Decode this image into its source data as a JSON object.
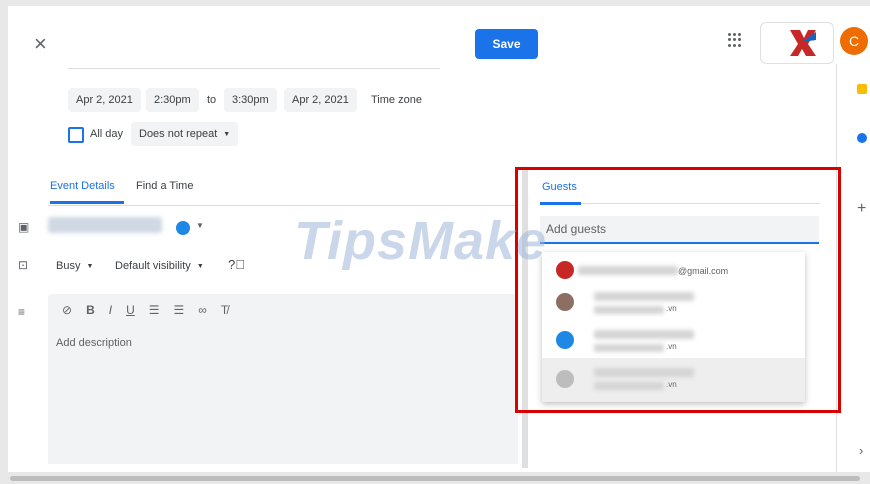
{
  "header": {
    "close_icon": "close-icon",
    "save_label": "Save",
    "apps_icon": "apps-grid-icon",
    "avatar_initial": "C"
  },
  "datetime": {
    "start_date": "Apr 2, 2021",
    "start_time": "2:30pm",
    "to_label": "to",
    "end_time": "3:30pm",
    "end_date": "Apr 2, 2021",
    "timezone_label": "Time zone",
    "all_day_label": "All day",
    "repeat_value": "Does not repeat"
  },
  "tabs": {
    "event_details": "Event Details",
    "find_time": "Find a Time"
  },
  "details": {
    "busy_value": "Busy",
    "visibility_value": "Default visibility",
    "description_placeholder": "Add description",
    "accent_color": "#1e88e5"
  },
  "guests": {
    "title": "Guests",
    "input_placeholder": "Add guests",
    "suggestions": [
      {
        "suffix": "@gmail.com",
        "avatar_color": "#c62828"
      },
      {
        "suffix": ".vn",
        "avatar_color": "#8d6e63"
      },
      {
        "suffix": ".vn",
        "avatar_color": "#1e88e5"
      },
      {
        "suffix": ".vn",
        "avatar_color": "#bdbdbd"
      }
    ]
  },
  "watermark": "TipsMake",
  "colors": {
    "primary": "#1a73e8",
    "highlight_box": "#d90000"
  }
}
